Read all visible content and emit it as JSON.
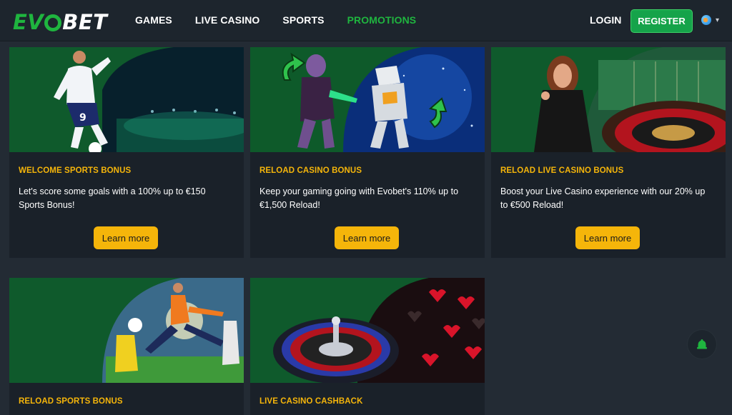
{
  "header": {
    "logo_text_ev": "EV",
    "logo_text_bet": "BET",
    "nav": [
      "GAMES",
      "LIVE CASINO",
      "SPORTS",
      "PROMOTIONS"
    ],
    "active_nav": "PROMOTIONS",
    "login_label": "LOGIN",
    "register_label": "REGISTER",
    "language_icon": "globe-icon"
  },
  "colors": {
    "brand_green": "#1fb53f",
    "accent_yellow": "#f5b50a",
    "background": "#232b34",
    "card": "#1a2129"
  },
  "promotions": [
    {
      "title": "WELCOME SPORTS BONUS",
      "description": "Let's score some goals with a 100% up to €150 Sports Bonus!",
      "button": "Learn more",
      "image": "football-player-stadium"
    },
    {
      "title": "RELOAD CASINO BONUS",
      "description": "Keep your gaming going with Evobet's 110% up to €1,500 Reload!",
      "button": "Learn more",
      "image": "alien-robot-space"
    },
    {
      "title": "RELOAD LIVE CASINO BONUS",
      "description": "Boost your Live Casino experience with our 20% up to €500 Reload!",
      "button": "Learn more",
      "image": "dealer-roulette-table"
    },
    {
      "title": "RELOAD SPORTS BONUS",
      "description": "",
      "button": "",
      "image": "football-kick-stadium"
    },
    {
      "title": "LIVE CASINO CASHBACK",
      "description": "",
      "button": "",
      "image": "roulette-wheel-hearts"
    }
  ],
  "chat_button_icon": "bell-icon"
}
